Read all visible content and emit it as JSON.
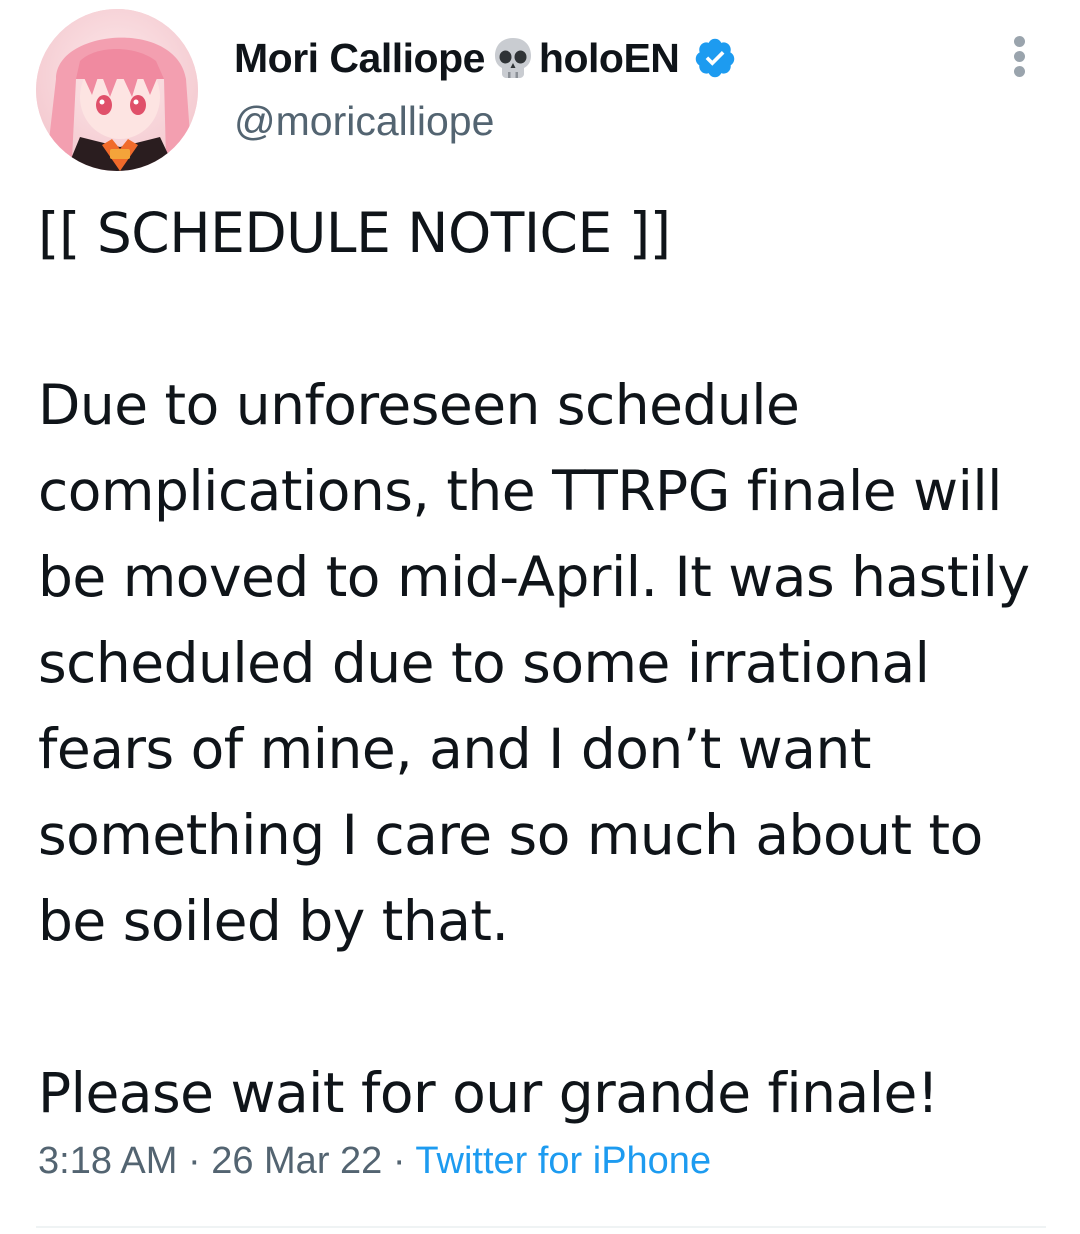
{
  "author": {
    "display_name": "Mori Calliope",
    "display_name_suffix": "holoEN",
    "emoji_icon": "skull-icon",
    "verified_icon": "verified-badge-icon",
    "handle": "@moricalliope",
    "avatar": "avatar-image"
  },
  "menu": {
    "icon": "more-options-icon"
  },
  "tweet": {
    "paragraphs": [
      "[[ SCHEDULE NOTICE ]]",
      "Due to unforeseen schedule complications, the TTRPG finale will be moved to mid-April. It was hastily scheduled due to some irrational fears of mine, and I don’t want something I care so much about to be soiled by that.",
      "Please wait for our grande finale!"
    ],
    "time": "3:18 AM",
    "separator": "·",
    "date": "26 Mar 22",
    "source": "Twitter for iPhone"
  },
  "colors": {
    "text": "#0f1419",
    "secondary": "#536471",
    "accent": "#1d9bf0"
  }
}
